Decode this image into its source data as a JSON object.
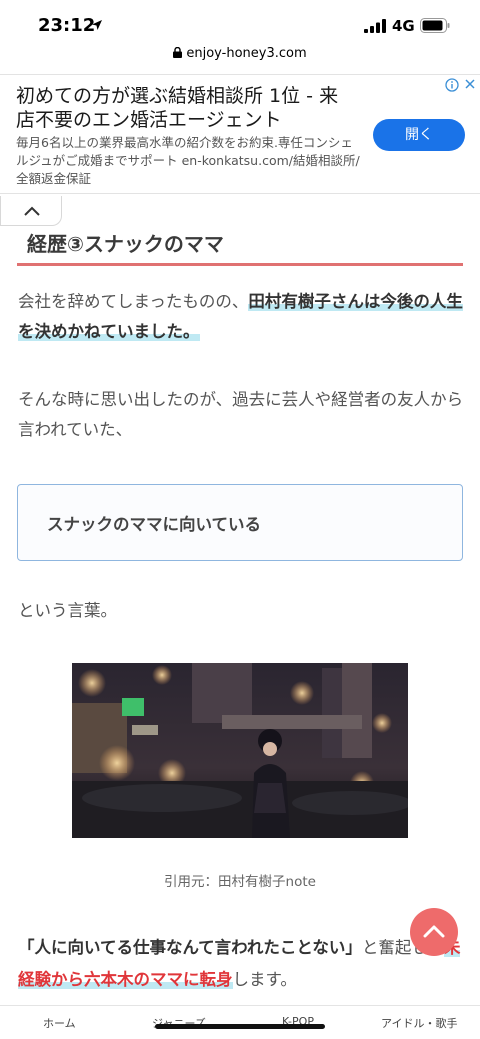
{
  "status": {
    "time": "23:12",
    "network": "4G"
  },
  "url": "enjoy-honey3.com",
  "ad": {
    "headline": "初めての方が選ぶ結婚相談所 1位 - 来店不要のエン婚活エージェント",
    "description": "毎月6名以上の業界最高水準の紹介数をお約束.専任コンシェルジュがご成婚までサポート en-konkatsu.com/結婚相談所/全額返金保証",
    "button": "開く"
  },
  "article": {
    "heading": "経歴③スナックのママ",
    "p1_plain": "会社を辞めてしまったものの、",
    "p1_highlight": "田村有樹子さんは今後の人生を決めかねていました。",
    "p2": "そんな時に思い出したのが、過去に芸人や経営者の友人から言われていた、",
    "box": "スナックのママに向いている",
    "p3": "という言葉。",
    "caption": "引用元：田村有樹子note",
    "p4_quote": "「人に向いてる仕事なんて言われたことない」",
    "p4_mid": "と奮起して",
    "p4_red": "未経験から六本木のママに転身",
    "p4_end": "します。"
  },
  "nav": {
    "items": [
      "ホーム",
      "ジャニーズ",
      "K-POP",
      "アイドル・歌手"
    ]
  },
  "colors": {
    "accent": "#e07171",
    "highlight": "#bfe9f3",
    "red": "#e0363a",
    "ad_button": "#1a73e8"
  }
}
